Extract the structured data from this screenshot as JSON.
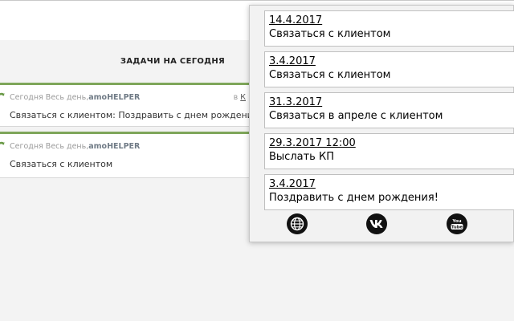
{
  "page": {
    "tasks_heading": "ЗАДАЧИ НА СЕГОДНЯ",
    "tasks": [
      {
        "when": "Сегодня Весь день,",
        "user": "amoHELPER",
        "link_prefix": "в",
        "link_text": "К",
        "text": "Связаться с клиентом: Поздравить с днем рождения!"
      },
      {
        "when": "Сегодня Весь день,",
        "user": "amoHELPER",
        "text": "Связаться с клиентом"
      }
    ]
  },
  "popup": {
    "reminders": [
      {
        "date": "14.4.2017",
        "title": "Связаться с клиентом"
      },
      {
        "date": "3.4.2017",
        "title": "Связаться с клиентом"
      },
      {
        "date": "31.3.2017",
        "title": "Связаться в апреле с клиентом"
      },
      {
        "date": "29.3.2017 12:00",
        "title": "Выслать КП"
      },
      {
        "date": "3.4.2017",
        "title": "Поздравить с днем рождения!"
      }
    ],
    "social_icons": [
      "globe-icon",
      "vk-icon",
      "youtube-icon"
    ],
    "youtube_label": "You Tube"
  },
  "colors": {
    "task_accent": "#7ea65a",
    "user_name": "#707b86",
    "icon_fill": "#111111"
  }
}
